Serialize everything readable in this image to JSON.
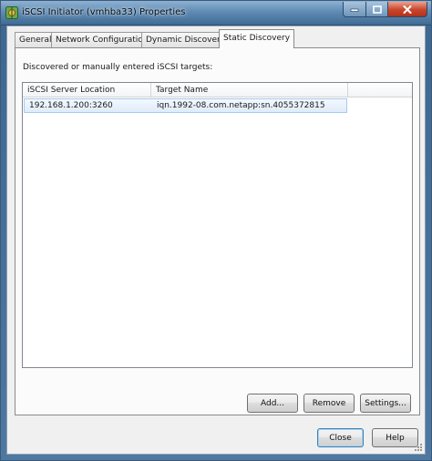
{
  "window": {
    "title": "iSCSI Initiator (vmhba33) Properties"
  },
  "tabs": [
    {
      "label": "General"
    },
    {
      "label": "Network Configuration"
    },
    {
      "label": "Dynamic Discovery"
    },
    {
      "label": "Static Discovery"
    }
  ],
  "active_tab": "Static Discovery",
  "panel": {
    "description": "Discovered or manually entered iSCSI targets:",
    "columns": [
      "iSCSI Server Location",
      "Target Name"
    ],
    "rows": [
      {
        "location": "192.168.1.200:3260",
        "target": "iqn.1992-08.com.netapp:sn.4055372815"
      }
    ],
    "buttons": {
      "add": "Add...",
      "remove": "Remove",
      "settings": "Settings..."
    }
  },
  "footer": {
    "close": "Close",
    "help": "Help"
  },
  "colors": {
    "titlebar": "#5f8bb4",
    "close_caption": "#c8452b",
    "selection": "#dfecfb"
  }
}
